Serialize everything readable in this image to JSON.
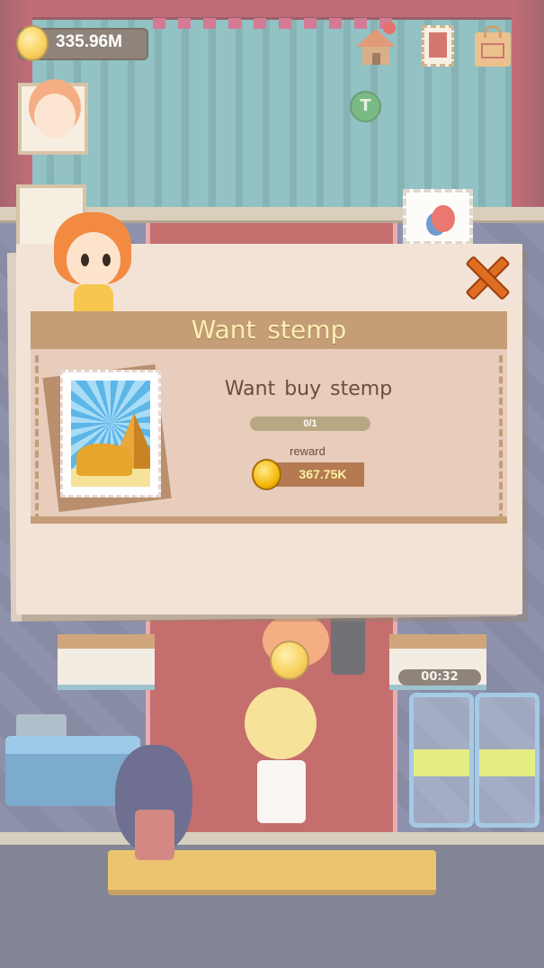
{
  "hud": {
    "coin_amount": "335.96M",
    "green_badge_letter": "T",
    "icons": [
      "coin-icon",
      "home-icon",
      "stamp-book-icon",
      "mail-bag-icon"
    ]
  },
  "scene": {
    "timer": "00:32"
  },
  "dialog": {
    "title": "Want stemp",
    "request_text": "Want buy stemp",
    "progress_text": "0/1",
    "progress_fraction": 0,
    "reward_label": "reward",
    "reward_amount": "367.75K",
    "close_icon": "close-icon",
    "stamp_subject": "sphinx-and-pyramid"
  },
  "colors": {
    "title_text": "#fbefb3",
    "title_bar": "#c59d76",
    "dialog_bg": "#f3e2d6",
    "close_orange": "#e06e22",
    "coin_gold": "#f5b90e"
  }
}
